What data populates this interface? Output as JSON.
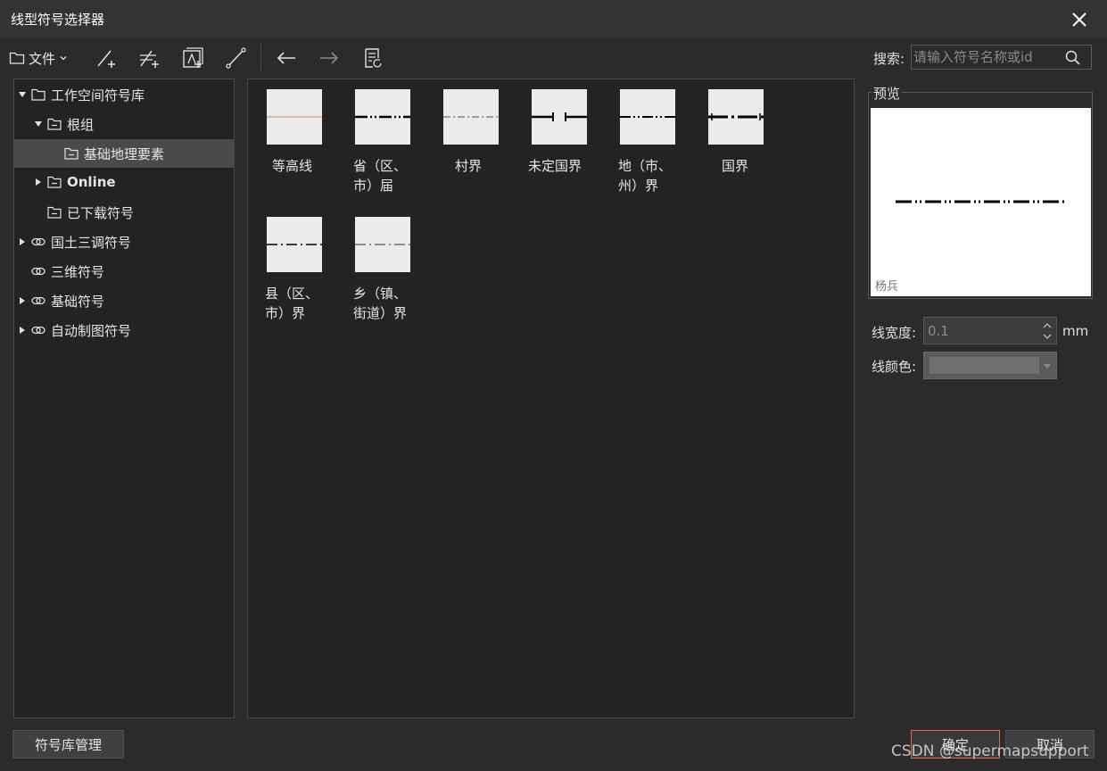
{
  "window": {
    "title": "线型符号选择器"
  },
  "toolbar": {
    "file_label": "文件"
  },
  "search": {
    "label": "搜索:",
    "placeholder": "请输入符号名称或id"
  },
  "tree": {
    "items": [
      {
        "label": "工作空间符号库"
      },
      {
        "label": "根组"
      },
      {
        "label": "基础地理要素"
      },
      {
        "label": "Online"
      },
      {
        "label": "已下载符号"
      },
      {
        "label": "国土三调符号"
      },
      {
        "label": "三维符号"
      },
      {
        "label": "基础符号"
      },
      {
        "label": "自动制图符号"
      }
    ]
  },
  "symbols": [
    {
      "line1": "等高线",
      "line2": ""
    },
    {
      "line1": "省（区、",
      "line2": "市）届"
    },
    {
      "line1": "村界",
      "line2": ""
    },
    {
      "line1": "未定国界",
      "line2": ""
    },
    {
      "line1": "地（市、",
      "line2": "州）界"
    },
    {
      "line1": "国界",
      "line2": ""
    },
    {
      "line1": "县（区、",
      "line2": "市）界"
    },
    {
      "line1": "乡（镇、",
      "line2": "街道）界"
    }
  ],
  "preview": {
    "title": "预览",
    "symbol_name": "杨兵"
  },
  "properties": {
    "width_label": "线宽度:",
    "width_value": "0.1",
    "width_unit": "mm",
    "color_label": "线颜色:",
    "color_value": "#6e6e6e"
  },
  "buttons": {
    "manage": "符号库管理",
    "ok": "确定",
    "cancel": "取消"
  },
  "watermark": "CSDN @supermapsupport",
  "colors": {
    "ok_border": "#e06b5b",
    "contour_line": "#d9a068"
  }
}
